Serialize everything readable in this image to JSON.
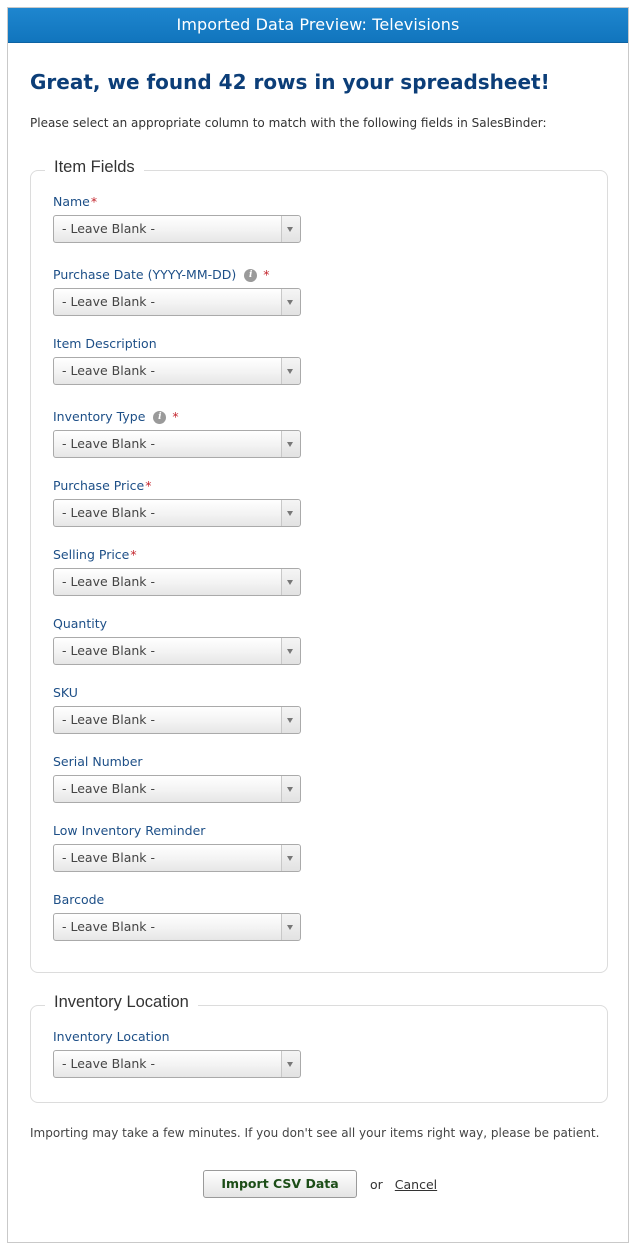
{
  "dialog": {
    "title": "Imported Data Preview: Televisions",
    "headline": "Great, we found 42 rows in your spreadsheet!",
    "intro": "Please select an appropriate column to match with the following fields in SalesBinder:"
  },
  "item_fields": {
    "legend": "Item Fields",
    "fields": [
      {
        "label": "Name",
        "required": true,
        "info": false,
        "value": "- Leave Blank -"
      },
      {
        "label": "Purchase Date (YYYY-MM-DD)",
        "required": true,
        "info": true,
        "value": "- Leave Blank -"
      },
      {
        "label": "Item Description",
        "required": false,
        "info": false,
        "value": "- Leave Blank -"
      },
      {
        "label": "Inventory Type",
        "required": true,
        "info": true,
        "value": "- Leave Blank -"
      },
      {
        "label": "Purchase Price",
        "required": true,
        "info": false,
        "value": "- Leave Blank -"
      },
      {
        "label": "Selling Price",
        "required": true,
        "info": false,
        "value": "- Leave Blank -"
      },
      {
        "label": "Quantity",
        "required": false,
        "info": false,
        "value": "- Leave Blank -"
      },
      {
        "label": "SKU",
        "required": false,
        "info": false,
        "value": "- Leave Blank -"
      },
      {
        "label": "Serial Number",
        "required": false,
        "info": false,
        "value": "- Leave Blank -"
      },
      {
        "label": "Low Inventory Reminder",
        "required": false,
        "info": false,
        "value": "- Leave Blank -"
      },
      {
        "label": "Barcode",
        "required": false,
        "info": false,
        "value": "- Leave Blank -"
      }
    ]
  },
  "inventory_location": {
    "legend": "Inventory Location",
    "fields": [
      {
        "label": "Inventory Location",
        "required": false,
        "info": false,
        "value": "- Leave Blank -"
      }
    ]
  },
  "required_marker": "*",
  "info_glyph": "i",
  "notice": "Importing may take a few minutes. If you don't see all your items right way, please be patient.",
  "actions": {
    "import_label": "Import CSV Data",
    "or_text": "or",
    "cancel_label": "Cancel"
  },
  "colors": {
    "title_bar": "#1a7fc8",
    "headline": "#0c3e78",
    "label": "#1d4f87",
    "required": "#c4262e",
    "import_button_text": "#1c4d17"
  },
  "icons": {
    "info": "info-circle-icon",
    "dropdown": "chevron-down-icon"
  }
}
